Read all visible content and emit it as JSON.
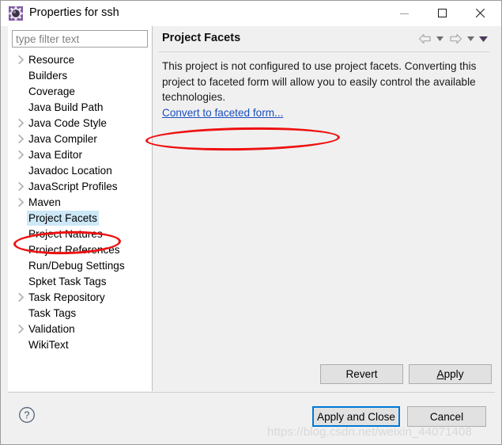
{
  "window": {
    "title": "Properties for ssh",
    "icon": "properties-gear-icon",
    "controls": {
      "minimize": "minimize-icon",
      "maximize": "maximize-icon",
      "close": "close-icon"
    }
  },
  "sidebar": {
    "filter": {
      "value": "",
      "placeholder": "type filter text"
    },
    "items": [
      {
        "label": "Resource",
        "expandable": true,
        "selected": false
      },
      {
        "label": "Builders",
        "expandable": false,
        "selected": false
      },
      {
        "label": "Coverage",
        "expandable": false,
        "selected": false
      },
      {
        "label": "Java Build Path",
        "expandable": false,
        "selected": false
      },
      {
        "label": "Java Code Style",
        "expandable": true,
        "selected": false
      },
      {
        "label": "Java Compiler",
        "expandable": true,
        "selected": false
      },
      {
        "label": "Java Editor",
        "expandable": true,
        "selected": false
      },
      {
        "label": "Javadoc Location",
        "expandable": false,
        "selected": false
      },
      {
        "label": "JavaScript Profiles",
        "expandable": true,
        "selected": false
      },
      {
        "label": "Maven",
        "expandable": true,
        "selected": false
      },
      {
        "label": "Project Facets",
        "expandable": false,
        "selected": true
      },
      {
        "label": "Project Natures",
        "expandable": false,
        "selected": false
      },
      {
        "label": "Project References",
        "expandable": false,
        "selected": false
      },
      {
        "label": "Run/Debug Settings",
        "expandable": false,
        "selected": false
      },
      {
        "label": "Spket Task Tags",
        "expandable": false,
        "selected": false
      },
      {
        "label": "Task Repository",
        "expandable": true,
        "selected": false
      },
      {
        "label": "Task Tags",
        "expandable": false,
        "selected": false
      },
      {
        "label": "Validation",
        "expandable": true,
        "selected": false
      },
      {
        "label": "WikiText",
        "expandable": false,
        "selected": false
      }
    ]
  },
  "page": {
    "title": "Project Facets",
    "description": "This project is not configured to use project facets. Converting this project to faceted form will allow you to easily control the available technologies.",
    "link_label": "Convert to faceted form...",
    "toolbar": [
      {
        "name": "back-arrow-icon",
        "glyph": "back-arrow"
      },
      {
        "name": "back-history-dropdown",
        "glyph": "triangle-down-small"
      },
      {
        "name": "forward-arrow-icon",
        "glyph": "forward-arrow"
      },
      {
        "name": "forward-history-dropdown",
        "glyph": "triangle-down-small"
      },
      {
        "name": "page-menu-icon",
        "glyph": "triangle-down-filled"
      }
    ]
  },
  "buttons": {
    "revert": "Revert",
    "apply": "Apply",
    "apply_mnemonic": "A",
    "apply_rest": "pply",
    "apply_and_close": "Apply and Close",
    "cancel": "Cancel",
    "help": "?"
  },
  "annotations": [
    {
      "name": "tree-highlight-ellipse",
      "target": "Project Facets",
      "color": "#ee1111"
    },
    {
      "name": "link-highlight-ellipse",
      "target": "Convert to faceted form...",
      "color": "#ee1111"
    }
  ],
  "watermark": "https://blog.csdn.net/weixin_44071408",
  "colors": {
    "selection": "#cde8f6",
    "link": "#1a4fc0",
    "annotation": "#ee1111",
    "default_button_focus": "#0078d7",
    "panel_bg": "#f0f0f0"
  }
}
